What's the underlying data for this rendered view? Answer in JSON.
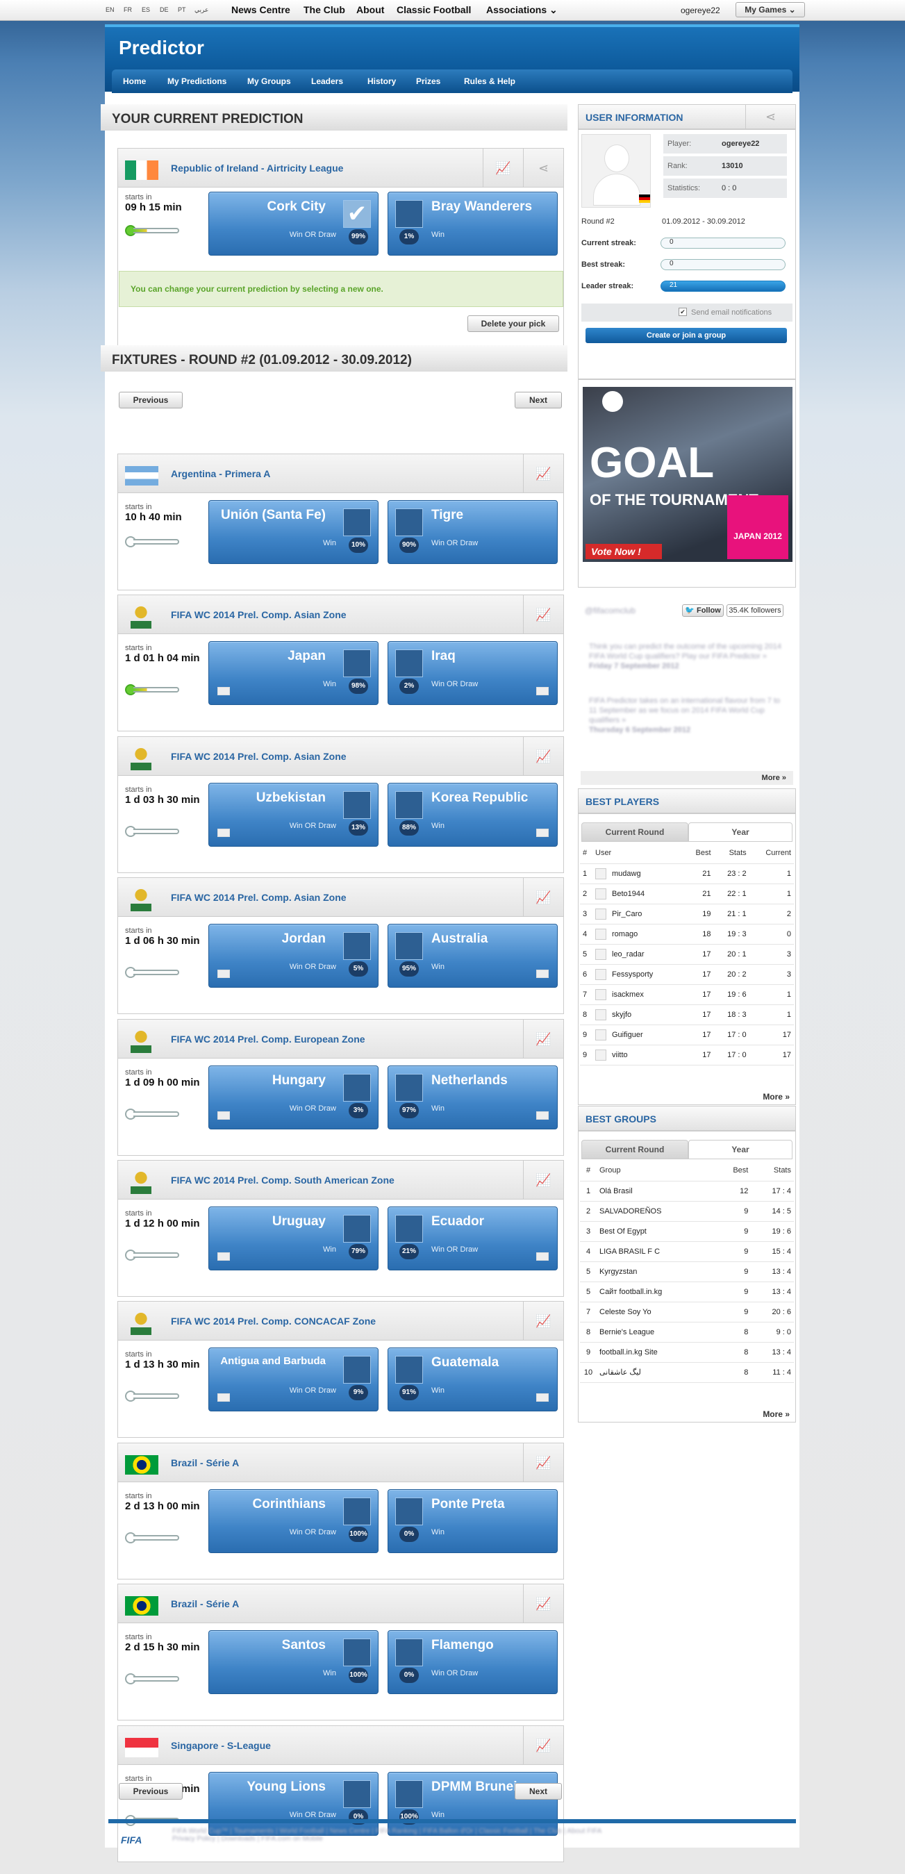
{
  "topbar": {
    "langs": [
      "EN",
      "FR",
      "ES",
      "DE",
      "PT",
      "عربي"
    ],
    "nav": [
      "News Centre",
      "The Club",
      "About",
      "Classic Football",
      "Associations ⌄"
    ],
    "user": "ogereye22",
    "mygames": "My Games ⌄"
  },
  "header": {
    "logo": "Predictor",
    "menu": [
      "Home",
      "My Predictions",
      "My Groups",
      "Leaders",
      "History",
      "Prizes",
      "Rules & Help"
    ]
  },
  "current": {
    "title": "YOUR CURRENT PREDICTION",
    "league": "Republic of Ireland - Airtricity League",
    "starts_label": "starts in",
    "starts": "09 h 15 min",
    "home": "Cork City",
    "home_res": "Win OR Draw",
    "home_pct": "99%",
    "away": "Bray Wanderers",
    "away_res": "Win",
    "away_pct": "1%",
    "notice": "You can change your current prediction by selecting a new one.",
    "delete": "Delete your pick"
  },
  "fixtures": {
    "title": "FIXTURES - ROUND #2 (01.09.2012 - 30.09.2012)",
    "prev": "Previous",
    "next": "Next",
    "items": [
      {
        "league": "Argentina - Primera A",
        "starts": "10 h 40 min",
        "home": "Unión (Santa Fe)",
        "home_res": "Win",
        "home_pct": "10%",
        "away": "Tigre",
        "away_res": "Win OR Draw",
        "away_pct": "90%"
      },
      {
        "league": "FIFA WC 2014 Prel. Comp. Asian Zone",
        "starts": "1 d 01 h 04 min",
        "home": "Japan",
        "home_res": "Win",
        "home_pct": "98%",
        "away": "Iraq",
        "away_res": "Win OR Draw",
        "away_pct": "2%"
      },
      {
        "league": "FIFA WC 2014 Prel. Comp. Asian Zone",
        "starts": "1 d 03 h 30 min",
        "home": "Uzbekistan",
        "home_res": "Win OR Draw",
        "home_pct": "13%",
        "away": "Korea Republic",
        "away_res": "Win",
        "away_pct": "88%"
      },
      {
        "league": "FIFA WC 2014 Prel. Comp. Asian Zone",
        "starts": "1 d 06 h 30 min",
        "home": "Jordan",
        "home_res": "Win OR Draw",
        "home_pct": "5%",
        "away": "Australia",
        "away_res": "Win",
        "away_pct": "95%"
      },
      {
        "league": "FIFA WC 2014 Prel. Comp. European Zone",
        "starts": "1 d 09 h 00 min",
        "home": "Hungary",
        "home_res": "Win OR Draw",
        "home_pct": "3%",
        "away": "Netherlands",
        "away_res": "Win",
        "away_pct": "97%"
      },
      {
        "league": "FIFA WC 2014 Prel. Comp. South American Zone",
        "starts": "1 d 12 h 00 min",
        "home": "Uruguay",
        "home_res": "Win",
        "home_pct": "79%",
        "away": "Ecuador",
        "away_res": "Win OR Draw",
        "away_pct": "21%"
      },
      {
        "league": "FIFA WC 2014 Prel. Comp. CONCACAF Zone",
        "starts": "1 d 13 h 30 min",
        "home": "Antigua and Barbuda",
        "home_res": "Win OR Draw",
        "home_pct": "9%",
        "away": "Guatemala",
        "away_res": "Win",
        "away_pct": "91%"
      },
      {
        "league": "Brazil - Série A",
        "starts": "2 d 13 h 00 min",
        "home": "Corinthians",
        "home_res": "Win OR Draw",
        "home_pct": "100%",
        "away": "Ponte Preta",
        "away_res": "Win",
        "away_pct": "0%"
      },
      {
        "league": "Brazil - Série A",
        "starts": "2 d 15 h 30 min",
        "home": "Santos",
        "home_res": "Win",
        "home_pct": "100%",
        "away": "Flamengo",
        "away_res": "Win OR Draw",
        "away_pct": "0%"
      },
      {
        "league": "Singapore - S-League",
        "starts": "3 d 02 h 15 min",
        "home": "Young Lions",
        "home_res": "Win OR Draw",
        "home_pct": "0%",
        "away": "DPMM Brunei",
        "away_res": "Win",
        "away_pct": "100%"
      }
    ]
  },
  "userinfo": {
    "title": "USER INFORMATION",
    "player_lbl": "Player:",
    "player": "ogereye22",
    "rank_lbl": "Rank:",
    "rank": "13010",
    "stats_lbl": "Statistics:",
    "stats": "0 : 0",
    "round_lbl": "Round #2",
    "round": "01.09.2012 - 30.09.2012",
    "cur_lbl": "Current streak:",
    "cur": "0",
    "best_lbl": "Best streak:",
    "best": "0",
    "leader_lbl": "Leader streak:",
    "leader": "21",
    "email": "Send email notifications",
    "join": "Create or join a group"
  },
  "banner": {
    "l1": "GOAL",
    "l2": "OF THE TOURNAMENT",
    "vote": "Vote Now !",
    "japan": "JAPAN 2012"
  },
  "twitter": {
    "follow": "Follow",
    "followers": "35.4K followers",
    "more": "More »"
  },
  "bestplayers": {
    "title": "BEST PLAYERS",
    "tab1": "Current Round",
    "tab2": "Year",
    "h": [
      "#",
      "User",
      "Best",
      "Stats",
      "Current"
    ],
    "rows": [
      [
        "1",
        "mudawg",
        "21",
        "23 : 2",
        "1"
      ],
      [
        "2",
        "Beto1944",
        "21",
        "22 : 1",
        "1"
      ],
      [
        "3",
        "Pir_Caro",
        "19",
        "21 : 1",
        "2"
      ],
      [
        "4",
        "romago",
        "18",
        "19 : 3",
        "0"
      ],
      [
        "5",
        "leo_radar",
        "17",
        "20 : 1",
        "3"
      ],
      [
        "6",
        "Fessysporty",
        "17",
        "20 : 2",
        "3"
      ],
      [
        "7",
        "isackmex",
        "17",
        "19 : 6",
        "1"
      ],
      [
        "8",
        "skyjfo",
        "17",
        "18 : 3",
        "1"
      ],
      [
        "9",
        "Guifiguer",
        "17",
        "17 : 0",
        "17"
      ],
      [
        "9",
        "viitto",
        "17",
        "17 : 0",
        "17"
      ]
    ],
    "more": "More »"
  },
  "bestgroups": {
    "title": "BEST GROUPS",
    "tab1": "Current Round",
    "tab2": "Year",
    "h": [
      "#",
      "Group",
      "Best",
      "Stats"
    ],
    "rows": [
      [
        "1",
        "Olá Brasil",
        "12",
        "17 : 4"
      ],
      [
        "2",
        "SALVADOREÑOS",
        "9",
        "14 : 5"
      ],
      [
        "3",
        "Best Of Egypt",
        "9",
        "19 : 6"
      ],
      [
        "4",
        "LIGA BRASIL F C",
        "9",
        "15 : 4"
      ],
      [
        "5",
        "Kyrgyzstan",
        "9",
        "13 : 4"
      ],
      [
        "5",
        "Сайт football.in.kg",
        "9",
        "13 : 4"
      ],
      [
        "7",
        "Celeste Soy Yo",
        "9",
        "20 : 6"
      ],
      [
        "8",
        "Bernie's League",
        "8",
        "9 : 0"
      ],
      [
        "9",
        "football.in.kg Site",
        "8",
        "13 : 4"
      ],
      [
        "10",
        "لیگ عاشقانی",
        "8",
        "11 : 4"
      ]
    ],
    "more": "More »"
  }
}
